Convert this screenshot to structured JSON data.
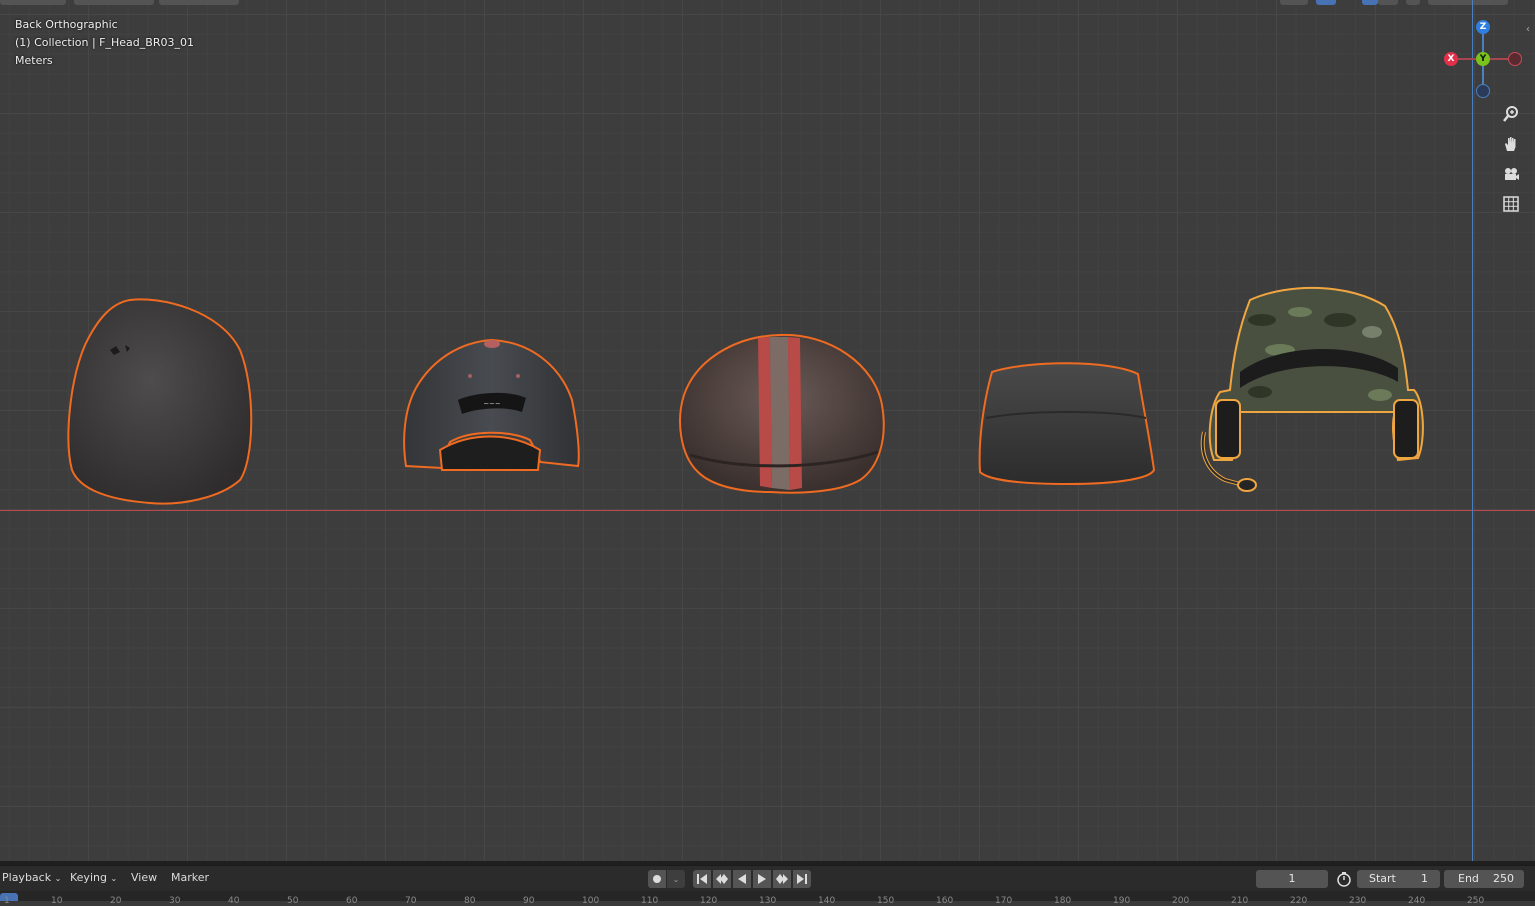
{
  "viewport": {
    "view_name": "Back Orthographic",
    "collection_line": "(1) Collection | F_Head_BR03_01",
    "units": "Meters",
    "colors": {
      "x_axis": "#b8474f",
      "z_axis": "#4a80c0",
      "selection_outline": "#ef6b21",
      "active_outline": "#f0a640"
    },
    "objects": [
      "beanie",
      "baseball-cap",
      "flat-cap",
      "field-cap",
      "camo-cap-with-headset"
    ],
    "gizmo": {
      "z": "Z",
      "x": "X",
      "y": "Y"
    },
    "nav_icons": [
      "zoom-icon",
      "hand-pan-icon",
      "camera-icon",
      "grid-icon"
    ]
  },
  "timeline": {
    "menus": {
      "playback": "Playback",
      "keying": "Keying",
      "view": "View",
      "marker": "Marker"
    },
    "current_frame": "1",
    "start_label": "Start",
    "start_value": "1",
    "end_label": "End",
    "end_value": "250",
    "ruler_ticks": [
      "1",
      "10",
      "20",
      "30",
      "40",
      "50",
      "60",
      "70",
      "80",
      "90",
      "100",
      "110",
      "120",
      "130",
      "140",
      "150",
      "160",
      "170",
      "180",
      "190",
      "200",
      "210",
      "220",
      "230",
      "240",
      "250"
    ]
  }
}
